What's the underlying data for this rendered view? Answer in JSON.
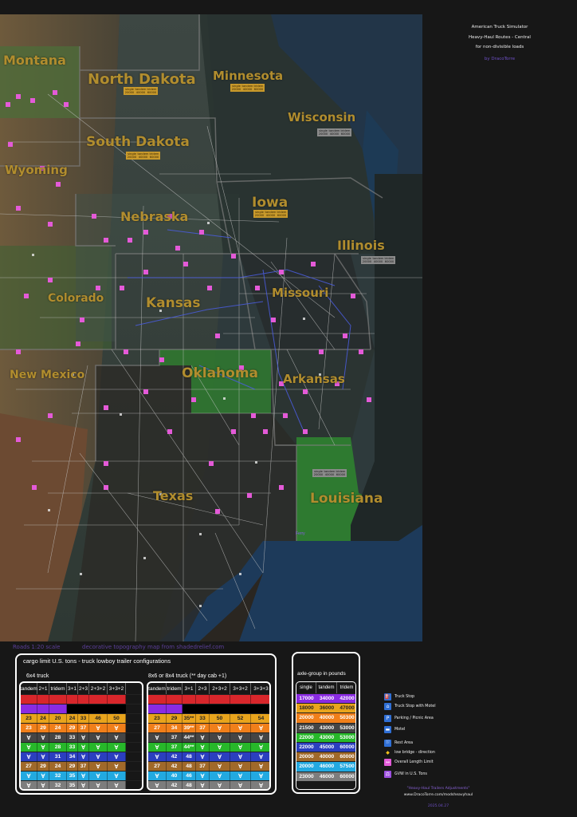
{
  "title": {
    "line1": "American Truck Simulator",
    "line2": "Heavy-Haul Routes - Central",
    "line3": "for non-divisible loads",
    "author": "by DracoTorre"
  },
  "map": {
    "state_labels": [
      {
        "name": "Montana",
        "color": "#b18d2e"
      },
      {
        "name": "North Dakota",
        "color": "#b18d2e"
      },
      {
        "name": "Minnesota",
        "color": "#b18d2e"
      },
      {
        "name": "Wisconsin",
        "color": "#b18d2e"
      },
      {
        "name": "South Dakota",
        "color": "#b18d2e"
      },
      {
        "name": "Wyoming",
        "color": "#b18d2e"
      },
      {
        "name": "Iowa",
        "color": "#b18d2e"
      },
      {
        "name": "Nebraska",
        "color": "#b18d2e"
      },
      {
        "name": "Illinois",
        "color": "#b18d2e"
      },
      {
        "name": "Colorado",
        "color": "#b18d2e"
      },
      {
        "name": "Kansas",
        "color": "#b18d2e"
      },
      {
        "name": "Missouri",
        "color": "#b18d2e"
      },
      {
        "name": "New Mexico",
        "color": "#b18d2e"
      },
      {
        "name": "Oklahoma",
        "color": "#b18d2e"
      },
      {
        "name": "Arkansas",
        "color": "#b18d2e"
      },
      {
        "name": "Texas",
        "color": "#b18d2e"
      },
      {
        "name": "Louisiana",
        "color": "#b18d2e"
      }
    ],
    "axle_boxes": [
      {
        "style": "gold",
        "header": [
          "single",
          "tandem",
          "tridem"
        ],
        "values": [
          "20000",
          "40000",
          "60000"
        ]
      },
      {
        "style": "gold",
        "header": [
          "single",
          "tandem",
          "tridem"
        ],
        "values": [
          "20000",
          "40000",
          "60000"
        ]
      },
      {
        "style": "gray",
        "header": [
          "single",
          "tandem",
          "tridem"
        ],
        "values": [
          "20000",
          "40000",
          "60000"
        ]
      },
      {
        "style": "gold",
        "header": [
          "single",
          "tandem",
          "tridem"
        ],
        "values": [
          "20000",
          "40000",
          "60000"
        ]
      },
      {
        "style": "gold",
        "header": [
          "single",
          "tandem",
          "tridem"
        ],
        "values": [
          "20000",
          "40000",
          "60000"
        ]
      },
      {
        "style": "gray",
        "header": [
          "single",
          "tandem",
          "tridem"
        ],
        "values": [
          "20000",
          "40000",
          "60000"
        ]
      },
      {
        "style": "gray",
        "header": [
          "single",
          "tandem",
          "tridem"
        ],
        "values": [
          "20000",
          "40000",
          "60000"
        ]
      }
    ],
    "ferry_label": "Ferry",
    "scale_label": "Roads 1:20 scale",
    "topo_credit": "decorative topography map from shadedrelief.com"
  },
  "tons_panel": {
    "title": "cargo limit U.S. tons - truck lowboy trailer configurations",
    "truck_6x4": {
      "label": "6x4 truck",
      "headers": [
        "tandem",
        "2+1",
        "tridem",
        "3+1",
        "2+3",
        "2+3+2",
        "3+3+2"
      ],
      "rows": [
        {
          "color": "#d8262b",
          "cells": [
            "",
            "",
            "",
            "",
            "",
            "",
            ""
          ]
        },
        {
          "color": "#8a2be2",
          "cells": [
            "",
            "",
            "",
            "",
            "",
            "",
            ""
          ],
          "partial": 3
        },
        {
          "color": "#e8a41c",
          "cells": [
            "23",
            "24",
            "20",
            "24",
            "33",
            "46",
            "50"
          ]
        },
        {
          "color": "#f07f1a",
          "cells": [
            "23",
            "29",
            "24",
            "29",
            "37",
            "∀",
            "∀"
          ]
        },
        {
          "color": "#454545",
          "cells": [
            "∀",
            "∀",
            "28",
            "33",
            "∀",
            "∀",
            "∀"
          ]
        },
        {
          "color": "#27b82a",
          "cells": [
            "∀",
            "∀",
            "28",
            "33",
            "∀",
            "∀",
            "∀"
          ]
        },
        {
          "color": "#2b3fbf",
          "cells": [
            "∀",
            "∀",
            "31",
            "34",
            "∀",
            "∀",
            "∀"
          ]
        },
        {
          "color": "#a0692a",
          "cells": [
            "27",
            "29",
            "24",
            "29",
            "37",
            "∀",
            "∀"
          ]
        },
        {
          "color": "#22a9e0",
          "cells": [
            "∀",
            "∀",
            "32",
            "35",
            "∀",
            "∀",
            "∀"
          ]
        },
        {
          "color": "#7d7d7d",
          "cells": [
            "∀",
            "∀",
            "32",
            "35",
            "∀",
            "∀",
            "∀"
          ]
        }
      ]
    },
    "truck_8x6": {
      "label": "8x6 or 8x4 truck (** day cab +1)",
      "headers": [
        "tandem",
        "tridem",
        "3+1",
        "2+3",
        "2+3+2",
        "3+3+2",
        "3+3+3"
      ],
      "rows": [
        {
          "color": "#d8262b",
          "cells": [
            "",
            "",
            "",
            "",
            "",
            "",
            ""
          ]
        },
        {
          "color": "#8a2be2",
          "cells": [
            "",
            "",
            "",
            "",
            "",
            "",
            ""
          ],
          "partial": 2
        },
        {
          "color": "#e8a41c",
          "cells": [
            "23",
            "29",
            "35**",
            "33",
            "50",
            "52",
            "54"
          ]
        },
        {
          "color": "#f07f1a",
          "cells": [
            "27",
            "34",
            "39**",
            "37",
            "∀",
            "∀",
            "∀"
          ]
        },
        {
          "color": "#454545",
          "cells": [
            "∀",
            "37",
            "44**",
            "∀",
            "∀",
            "∀",
            "∀"
          ]
        },
        {
          "color": "#27b82a",
          "cells": [
            "∀",
            "37",
            "44**",
            "∀",
            "∀",
            "∀",
            "∀"
          ]
        },
        {
          "color": "#2b3fbf",
          "cells": [
            "∀",
            "42",
            "48",
            "∀",
            "∀",
            "∀",
            "∀"
          ]
        },
        {
          "color": "#a0692a",
          "cells": [
            "27",
            "42",
            "48",
            "37",
            "∀",
            "∀",
            "∀"
          ]
        },
        {
          "color": "#22a9e0",
          "cells": [
            "∀",
            "40",
            "46",
            "∀",
            "∀",
            "∀",
            "∀"
          ]
        },
        {
          "color": "#7d7d7d",
          "cells": [
            "∀",
            "42",
            "48",
            "∀",
            "∀",
            "∀",
            "∀"
          ]
        }
      ]
    }
  },
  "axle_panel": {
    "title": "axle-group in pounds",
    "headers": [
      "single",
      "tandem",
      "tridem"
    ],
    "rows": [
      {
        "color": "#8a2be2",
        "cells": [
          "17000",
          "34000",
          "42000"
        ]
      },
      {
        "color": "#e8a41c",
        "cells": [
          "18000",
          "36000",
          "47000"
        ]
      },
      {
        "color": "#f07f1a",
        "cells": [
          "20000",
          "40000",
          "50300"
        ]
      },
      {
        "color": "#454545",
        "cells": [
          "21500",
          "43000",
          "53000"
        ]
      },
      {
        "color": "#27b82a",
        "cells": [
          "22000",
          "43000",
          "53000"
        ]
      },
      {
        "color": "#2b3fbf",
        "cells": [
          "22000",
          "45000",
          "60000"
        ]
      },
      {
        "color": "#a0692a",
        "cells": [
          "20000",
          "40000",
          "60000"
        ]
      },
      {
        "color": "#22a9e0",
        "cells": [
          "20000",
          "46000",
          "57500"
        ]
      },
      {
        "color": "#7d7d7d",
        "cells": [
          "23000",
          "46000",
          "60000"
        ]
      }
    ]
  },
  "legend": [
    {
      "icon": "truck-stop-icon",
      "label": "Truck Stop",
      "color": "#2f6fd6"
    },
    {
      "icon": "truck-stop-motel-icon",
      "label": "Truck Stop with Motel",
      "color": "#2f6fd6"
    },
    {
      "icon": "parking-icon",
      "label": "Parking / Picnic Area",
      "color": "#2f6fd6"
    },
    {
      "icon": "motel-icon",
      "label": "Motel",
      "color": "#2f6fd6"
    },
    {
      "icon": "rest-area-icon",
      "label": "Rest Area",
      "color": "#2f6fd6"
    },
    {
      "icon": "low-bridge-icon",
      "label": "low bridge - direction",
      "color": "#f2c21b"
    },
    {
      "icon": "overall-length-icon",
      "label": "Overall Length Limit",
      "color": "#e35bd9"
    },
    {
      "icon": "gvw-icon",
      "label": "GVW in U.S. Tons",
      "color": "#9c4fe0"
    }
  ],
  "footer": {
    "mod_name": "\"Heavy-Haul Trailers Adjustments\"",
    "url": "www.DracoTorre.com/modsheavyhaul",
    "date": "2025.04.27"
  }
}
